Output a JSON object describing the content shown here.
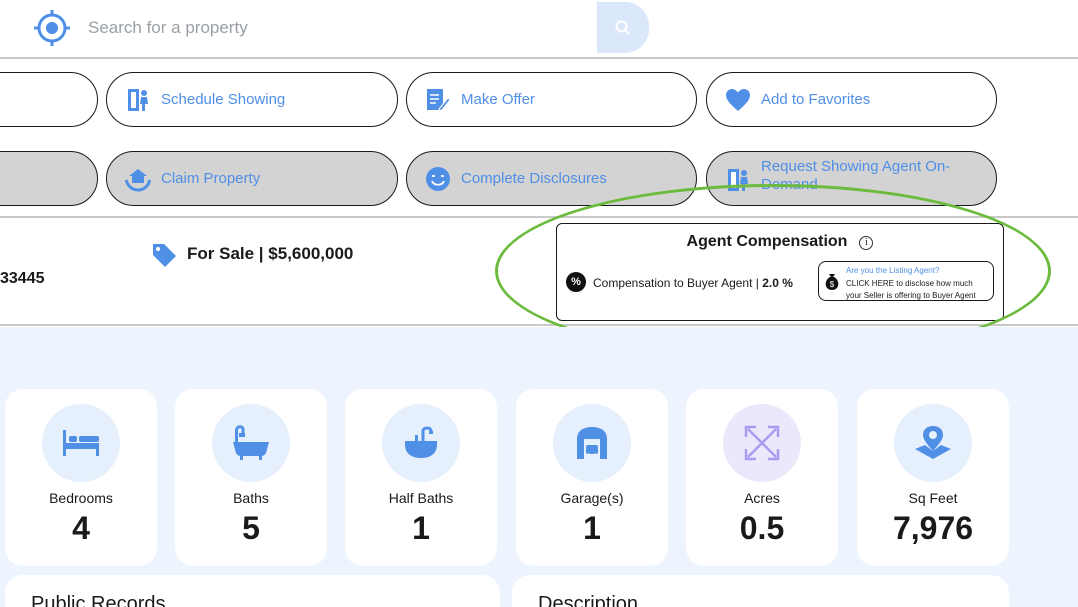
{
  "search": {
    "placeholder": "Search for a property"
  },
  "actions": {
    "row1": [
      {
        "label": ""
      },
      {
        "label": "Schedule Showing",
        "icon": "door-person-icon"
      },
      {
        "label": "Make Offer",
        "icon": "document-pen-icon"
      },
      {
        "label": "Add to Favorites",
        "icon": "heart-icon"
      }
    ],
    "row2": [
      {
        "label": ""
      },
      {
        "label": "Claim Property",
        "icon": "hands-house-icon"
      },
      {
        "label": "Complete Disclosures",
        "icon": "smiley-icon"
      },
      {
        "label": "Request Showing Agent On-Demand",
        "icon": "door-person-icon"
      }
    ]
  },
  "listing": {
    "zip_fragment": "33445",
    "sale_status": "For Sale | $5,600,000"
  },
  "agent_compensation": {
    "title": "Agent Compensation",
    "info_glyph": "i",
    "pct_glyph": "%",
    "label": "Compensation to Buyer Agent | ",
    "value": "2.0 %",
    "listing_agent_question": "Are you the Listing Agent?",
    "listing_agent_cta_bold": "CLICK HERE",
    "listing_agent_cta_rest": " to disclose how much",
    "listing_agent_cta_line2": "your Seller is offering to Buyer Agent"
  },
  "stats": [
    {
      "label": "Bedrooms",
      "value": "4",
      "icon": "bed-icon"
    },
    {
      "label": "Baths",
      "value": "5",
      "icon": "bathtub-icon"
    },
    {
      "label": "Half Baths",
      "value": "1",
      "icon": "sink-icon"
    },
    {
      "label": "Garage(s)",
      "value": "1",
      "icon": "garage-icon"
    },
    {
      "label": "Acres",
      "value": "0.5",
      "icon": "expand-arrows-icon"
    },
    {
      "label": "Sq Feet",
      "value": "7,976",
      "icon": "map-pin-icon"
    }
  ],
  "sections": {
    "public_records": "Public Records",
    "description": "Description"
  },
  "colors": {
    "accent": "#4f8fe6",
    "highlight": "#6dbb3e",
    "stats_background": "#eef4fd"
  }
}
